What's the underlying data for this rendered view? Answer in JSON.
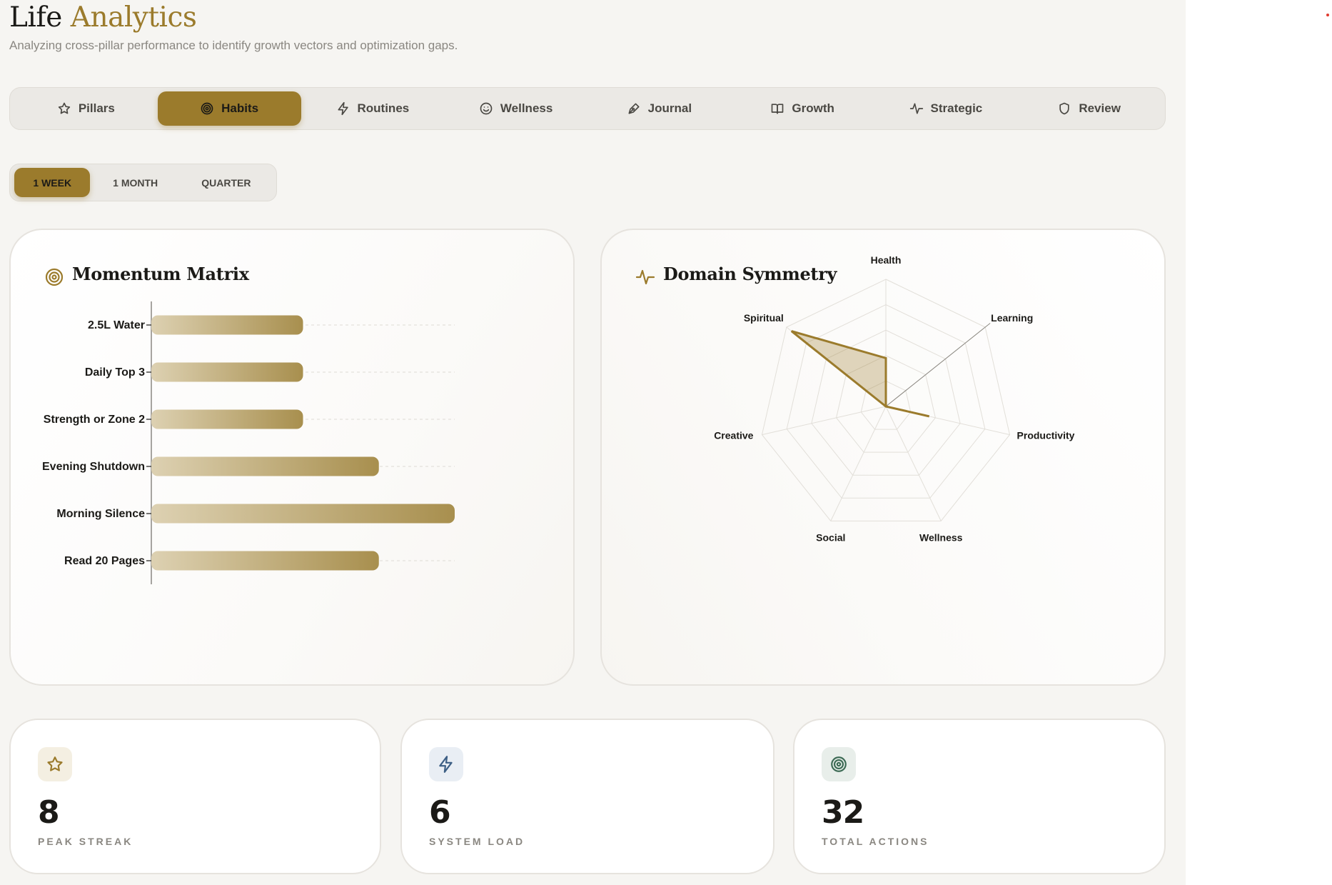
{
  "header": {
    "title_main": "Life",
    "title_accent": "Analytics",
    "subtitle": "Analyzing cross-pillar performance to identify growth vectors and optimization gaps."
  },
  "tabs": [
    {
      "label": "Pillars",
      "icon": "star-icon",
      "active": false
    },
    {
      "label": "Habits",
      "icon": "target-icon",
      "active": true
    },
    {
      "label": "Routines",
      "icon": "bolt-icon",
      "active": false
    },
    {
      "label": "Wellness",
      "icon": "smile-icon",
      "active": false
    },
    {
      "label": "Journal",
      "icon": "pen-icon",
      "active": false
    },
    {
      "label": "Growth",
      "icon": "book-icon",
      "active": false
    },
    {
      "label": "Strategic",
      "icon": "activity-icon",
      "active": false
    },
    {
      "label": "Review",
      "icon": "shield-icon",
      "active": false
    }
  ],
  "range": {
    "week": "1 WEEK",
    "month": "1 MONTH",
    "quarter": "QUARTER",
    "selected": "1 WEEK"
  },
  "momentum": {
    "title": "Momentum Matrix",
    "icon": "target-icon"
  },
  "symmetry": {
    "title": "Domain Symmetry",
    "icon": "activity-icon"
  },
  "colors": {
    "accent": "#9b7b2c",
    "bar_start": "#ddd1b2",
    "bar_end": "#a88f4e",
    "background": "#f6f5f2"
  },
  "chart_data": [
    {
      "type": "bar",
      "orientation": "horizontal",
      "categories": [
        "2.5L Water",
        "Daily Top 3",
        "Strength or Zone 2",
        "Evening Shutdown",
        "Morning Silence",
        "Read 20 Pages"
      ],
      "values": [
        5,
        5,
        5,
        7.5,
        10,
        7.5
      ],
      "xlim": [
        0,
        10
      ],
      "grid": true
    },
    {
      "type": "radar",
      "categories": [
        "Health",
        "Learning",
        "Productivity",
        "Wellness",
        "Social",
        "Creative",
        "Spiritual"
      ],
      "values": [
        3.8,
        0,
        3.5,
        0,
        0,
        0,
        9.5
      ],
      "rmax": 10,
      "grid": true
    }
  ],
  "stats": [
    {
      "value": "8",
      "label": "PEAK STREAK",
      "icon": "star-icon"
    },
    {
      "value": "6",
      "label": "SYSTEM LOAD",
      "icon": "bolt-icon"
    },
    {
      "value": "32",
      "label": "TOTAL ACTIONS",
      "icon": "target-icon"
    }
  ]
}
